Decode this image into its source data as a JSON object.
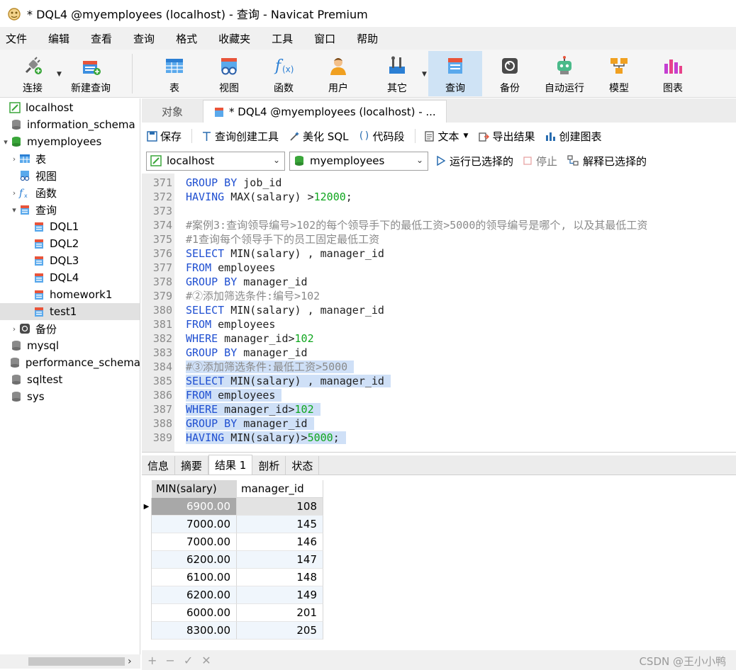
{
  "window": {
    "title": "* DQL4 @myemployees (localhost) - 查询 - Navicat Premium"
  },
  "menu": [
    "文件",
    "编辑",
    "查看",
    "查询",
    "格式",
    "收藏夹",
    "工具",
    "窗口",
    "帮助"
  ],
  "toolbar": {
    "connect": "连接",
    "new_query": "新建查询",
    "table": "表",
    "view": "视图",
    "function": "函数",
    "user": "用户",
    "other": "其它",
    "query": "查询",
    "backup": "备份",
    "automation": "自动运行",
    "model": "模型",
    "chart": "图表"
  },
  "sidebar": {
    "items": [
      {
        "label": "localhost",
        "icon": "connection-icon",
        "level": 0,
        "twisty": ""
      },
      {
        "label": "information_schema",
        "icon": "database-icon",
        "level": 1,
        "twisty": ""
      },
      {
        "label": "myemployees",
        "icon": "database-open-icon",
        "level": 1,
        "twisty": "▾"
      },
      {
        "label": "表",
        "icon": "table-icon",
        "level": 2,
        "twisty": "›"
      },
      {
        "label": "视图",
        "icon": "view-icon",
        "level": 2,
        "twisty": ""
      },
      {
        "label": "函数",
        "icon": "function-icon",
        "level": 2,
        "twisty": "›"
      },
      {
        "label": "查询",
        "icon": "query-icon",
        "level": 2,
        "twisty": "▾"
      },
      {
        "label": "DQL1",
        "icon": "query-icon",
        "level": 3,
        "twisty": ""
      },
      {
        "label": "DQL2",
        "icon": "query-icon",
        "level": 3,
        "twisty": ""
      },
      {
        "label": "DQL3",
        "icon": "query-icon",
        "level": 3,
        "twisty": ""
      },
      {
        "label": "DQL4",
        "icon": "query-icon",
        "level": 3,
        "twisty": ""
      },
      {
        "label": "homework1",
        "icon": "query-icon",
        "level": 3,
        "twisty": ""
      },
      {
        "label": "test1",
        "icon": "query-icon",
        "level": 3,
        "twisty": "",
        "selected": true
      },
      {
        "label": "备份",
        "icon": "backup-icon",
        "level": 2,
        "twisty": "›"
      },
      {
        "label": "mysql",
        "icon": "database-icon",
        "level": 1,
        "twisty": ""
      },
      {
        "label": "performance_schema",
        "icon": "database-icon",
        "level": 1,
        "twisty": ""
      },
      {
        "label": "sqltest",
        "icon": "database-icon",
        "level": 1,
        "twisty": ""
      },
      {
        "label": "sys",
        "icon": "database-icon",
        "level": 1,
        "twisty": ""
      }
    ]
  },
  "tabs": {
    "objects": "对象",
    "query_tab": "* DQL4 @myemployees (localhost) - ..."
  },
  "editor_toolbar": {
    "save": "保存",
    "query_builder": "查询创建工具",
    "beautify": "美化 SQL",
    "snippet": "代码段",
    "text": "文本",
    "export": "导出结果",
    "create_chart": "创建图表"
  },
  "connection_bar": {
    "connection": "localhost",
    "database": "myemployees",
    "run_selected": "运行已选择的",
    "stop": "停止",
    "explain_selected": "解释已选择的"
  },
  "code": [
    {
      "n": "371",
      "tokens": [
        [
          "kw",
          "GROUP BY"
        ],
        [
          "plain",
          " job_id"
        ]
      ]
    },
    {
      "n": "372",
      "tokens": [
        [
          "kw",
          "HAVING"
        ],
        [
          "plain",
          " MAX(salary) >"
        ],
        [
          "num",
          "12000"
        ],
        [
          "plain",
          ";"
        ]
      ]
    },
    {
      "n": "373",
      "tokens": []
    },
    {
      "n": "374",
      "tokens": [
        [
          "cm",
          "#案例3:查询领导编号>102的每个领导手下的最低工资>5000的领导编号是哪个, 以及其最低工资"
        ]
      ]
    },
    {
      "n": "375",
      "tokens": [
        [
          "cm",
          "#1查询每个领导手下的员工固定最低工资"
        ]
      ]
    },
    {
      "n": "376",
      "tokens": [
        [
          "kw",
          "SELECT"
        ],
        [
          "plain",
          " MIN(salary) , manager_id"
        ]
      ]
    },
    {
      "n": "377",
      "tokens": [
        [
          "kw",
          "FROM"
        ],
        [
          "plain",
          " employees"
        ]
      ]
    },
    {
      "n": "378",
      "tokens": [
        [
          "kw",
          "GROUP BY"
        ],
        [
          "plain",
          " manager_id"
        ]
      ]
    },
    {
      "n": "379",
      "tokens": [
        [
          "cm",
          "#②添加筛选条件:编号>102"
        ]
      ]
    },
    {
      "n": "380",
      "tokens": [
        [
          "kw",
          "SELECT"
        ],
        [
          "plain",
          " MIN(salary) , manager_id"
        ]
      ]
    },
    {
      "n": "381",
      "tokens": [
        [
          "kw",
          "FROM"
        ],
        [
          "plain",
          " employees"
        ]
      ]
    },
    {
      "n": "382",
      "tokens": [
        [
          "kw",
          "WHERE"
        ],
        [
          "plain",
          " manager_id>"
        ],
        [
          "num",
          "102"
        ]
      ]
    },
    {
      "n": "383",
      "tokens": [
        [
          "kw",
          "GROUP BY"
        ],
        [
          "plain",
          " manager_id"
        ]
      ]
    },
    {
      "n": "384",
      "sel": true,
      "tokens": [
        [
          "cm",
          "#③添加筛选条件:最低工资>5000"
        ]
      ]
    },
    {
      "n": "385",
      "sel": true,
      "tokens": [
        [
          "kw",
          "SELECT"
        ],
        [
          "plain",
          " MIN(salary) , manager_id"
        ]
      ]
    },
    {
      "n": "386",
      "sel": true,
      "tokens": [
        [
          "kw",
          "FROM"
        ],
        [
          "plain",
          " employees"
        ]
      ]
    },
    {
      "n": "387",
      "sel": true,
      "tokens": [
        [
          "kw",
          "WHERE"
        ],
        [
          "plain",
          " manager_id>"
        ],
        [
          "num",
          "102"
        ]
      ]
    },
    {
      "n": "388",
      "sel": true,
      "tokens": [
        [
          "kw",
          "GROUP BY"
        ],
        [
          "plain",
          " manager_id"
        ]
      ]
    },
    {
      "n": "389",
      "sel": true,
      "tokens": [
        [
          "kw",
          "HAVING"
        ],
        [
          "plain",
          " MIN(salary)>"
        ],
        [
          "num",
          "5000"
        ],
        [
          "plain",
          ";"
        ]
      ]
    }
  ],
  "result_tabs": [
    "信息",
    "摘要",
    "结果 1",
    "剖析",
    "状态"
  ],
  "result_active": 2,
  "result": {
    "columns": [
      "MIN(salary)",
      "manager_id"
    ],
    "rows": [
      [
        "6900.00",
        "108"
      ],
      [
        "7000.00",
        "145"
      ],
      [
        "7000.00",
        "146"
      ],
      [
        "6200.00",
        "147"
      ],
      [
        "6100.00",
        "148"
      ],
      [
        "6200.00",
        "149"
      ],
      [
        "6000.00",
        "201"
      ],
      [
        "8300.00",
        "205"
      ]
    ]
  },
  "bottom_bar": [
    "+",
    "−",
    "✓",
    "✕"
  ],
  "watermark": "CSDN @王小小鸭"
}
